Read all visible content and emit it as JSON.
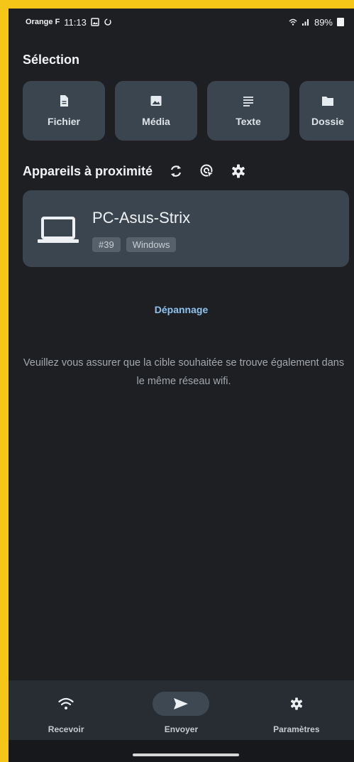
{
  "status_bar": {
    "carrier": "Orange F",
    "time": "11:13",
    "battery": "89%"
  },
  "selection": {
    "title": "Sélection",
    "buttons": [
      {
        "label": "Fichier",
        "icon": "file-icon"
      },
      {
        "label": "Média",
        "icon": "image-icon"
      },
      {
        "label": "Texte",
        "icon": "text-icon"
      },
      {
        "label": "Dossie",
        "icon": "folder-icon"
      }
    ]
  },
  "nearby": {
    "title": "Appareils à proximité",
    "icons": [
      "refresh-icon",
      "scan-icon",
      "settings-icon"
    ]
  },
  "device": {
    "name": "PC-Asus-Strix",
    "id_tag": "#39",
    "os_tag": "Windows",
    "icon": "laptop-icon"
  },
  "troubleshoot_label": "Dépannage",
  "hint": "Veuillez vous assurer que la cible souhaitée se trouve également dans le même réseau wifi.",
  "bottom_nav": {
    "receive": "Recevoir",
    "send": "Envoyer",
    "settings": "Paramètres",
    "active": "send"
  },
  "colors": {
    "frame": "#f5c518",
    "background": "#1e1f23",
    "card": "#3a4550",
    "link": "#8fc3ef"
  }
}
